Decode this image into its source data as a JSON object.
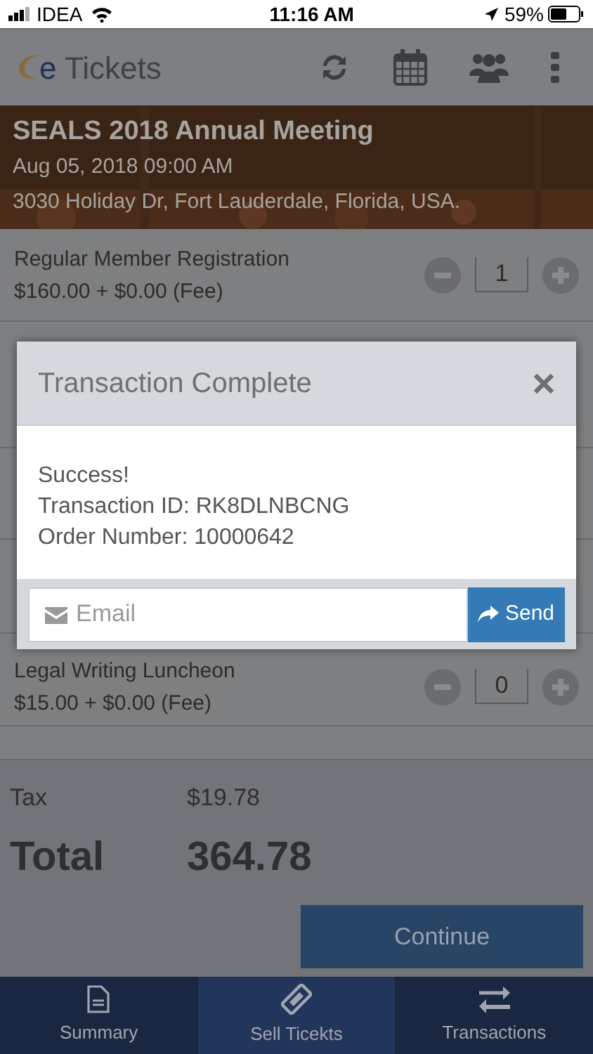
{
  "status_bar": {
    "carrier": "IDEA",
    "time": "11:16 AM",
    "battery": "59%"
  },
  "app_bar": {
    "logo_text": "e Tickets"
  },
  "event": {
    "title": "SEALS 2018 Annual Meeting",
    "date": "Aug 05, 2018 09:00 AM",
    "address": "3030 Holiday Dr, Fort Lauderdale, Florida, USA."
  },
  "tickets": [
    {
      "name": "Regular Member Registration",
      "price": "$160.00 + $0.00 (Fee)",
      "quantity": "1"
    },
    {
      "name": "Legal Writing Luncheon",
      "price": "$15.00 + $0.00 (Fee)",
      "quantity": "0"
    }
  ],
  "modal": {
    "title": "Transaction Complete",
    "lines": [
      "Success!",
      "Transaction ID: RK8DLNBCNG",
      "Order Number: 10000642"
    ],
    "email_placeholder": "Email",
    "send_label": "Send"
  },
  "summary": {
    "tax_label": "Tax",
    "tax_value": "$19.78",
    "total_label": "Total",
    "total_value": "364.78",
    "continue_label": "Continue"
  },
  "nav": [
    {
      "label": "Summary",
      "selected": false,
      "kind": "document"
    },
    {
      "label": "Sell Ticekts",
      "selected": true,
      "kind": "ticket"
    },
    {
      "label": "Transactions",
      "selected": false,
      "kind": "swap"
    }
  ]
}
